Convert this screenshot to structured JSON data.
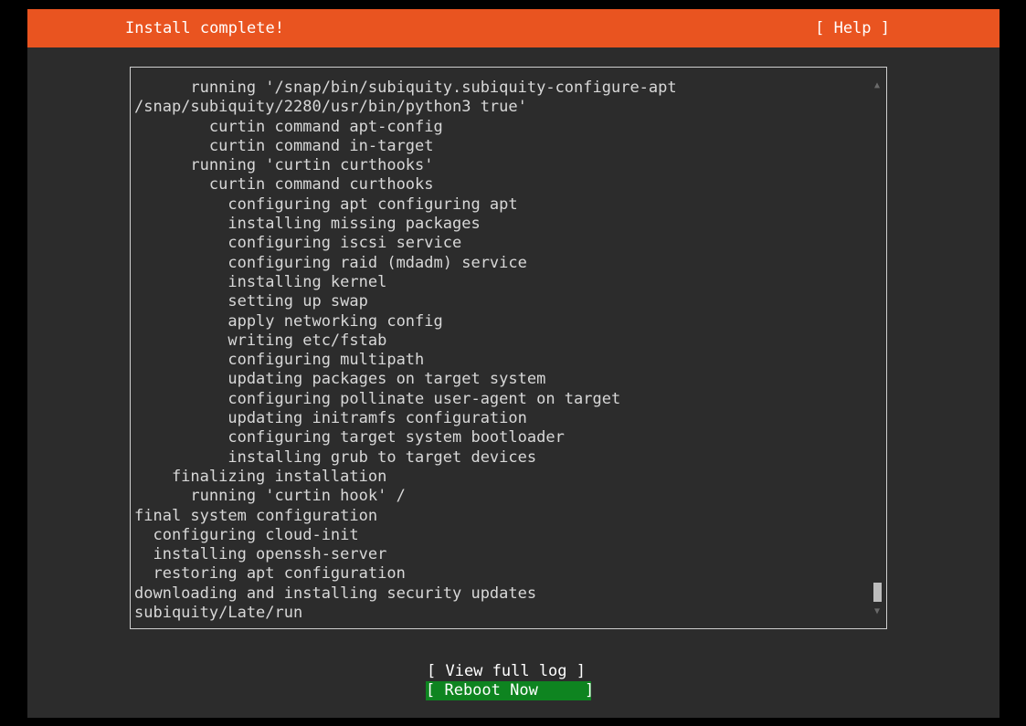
{
  "header": {
    "title": "Install complete!",
    "help_label": "[ Help ]"
  },
  "colors": {
    "header_bg": "#e95420",
    "screen_bg": "#2c2c2c",
    "focus_button_bg": "#0e8420"
  },
  "log": {
    "lines": [
      "      running '/snap/bin/subiquity.subiquity-configure-apt",
      "/snap/subiquity/2280/usr/bin/python3 true'",
      "        curtin command apt-config",
      "        curtin command in-target",
      "      running 'curtin curthooks'",
      "        curtin command curthooks",
      "          configuring apt configuring apt",
      "          installing missing packages",
      "          configuring iscsi service",
      "          configuring raid (mdadm) service",
      "          installing kernel",
      "          setting up swap",
      "          apply networking config",
      "          writing etc/fstab",
      "          configuring multipath",
      "          updating packages on target system",
      "          configuring pollinate user-agent on target",
      "          updating initramfs configuration",
      "          configuring target system bootloader",
      "          installing grub to target devices",
      "    finalizing installation",
      "      running 'curtin hook' /",
      "final system configuration",
      "  configuring cloud-init",
      "  installing openssh-server",
      "  restoring apt configuration",
      "downloading and installing security updates",
      "subiquity/Late/run"
    ],
    "scroll_up_glyph": "▲",
    "scroll_down_glyph": "▼"
  },
  "actions": {
    "view_log_label": "[ View full log ]",
    "reboot_label": "[ Reboot Now     ]"
  }
}
